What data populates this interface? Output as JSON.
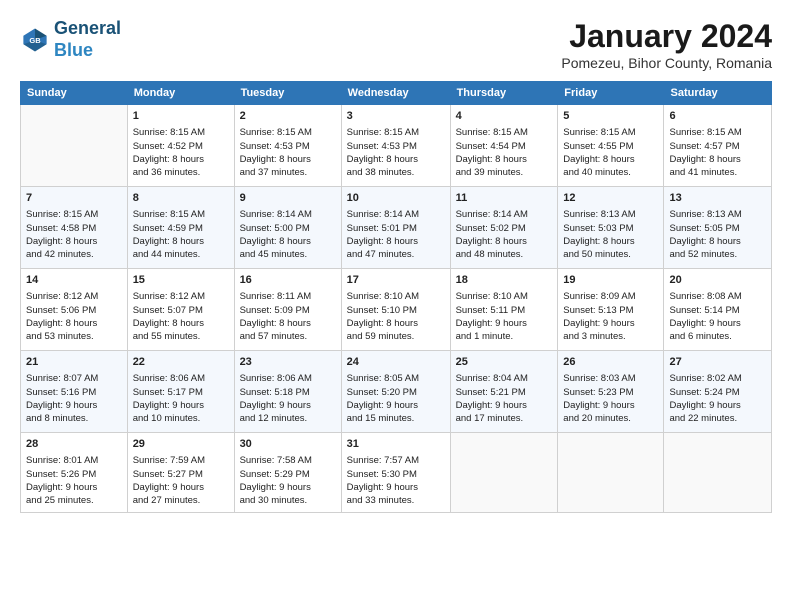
{
  "header": {
    "logo_line1": "General",
    "logo_line2": "Blue",
    "month_title": "January 2024",
    "subtitle": "Pomezeu, Bihor County, Romania"
  },
  "columns": [
    "Sunday",
    "Monday",
    "Tuesday",
    "Wednesday",
    "Thursday",
    "Friday",
    "Saturday"
  ],
  "weeks": [
    [
      {
        "day": "",
        "lines": []
      },
      {
        "day": "1",
        "lines": [
          "Sunrise: 8:15 AM",
          "Sunset: 4:52 PM",
          "Daylight: 8 hours",
          "and 36 minutes."
        ]
      },
      {
        "day": "2",
        "lines": [
          "Sunrise: 8:15 AM",
          "Sunset: 4:53 PM",
          "Daylight: 8 hours",
          "and 37 minutes."
        ]
      },
      {
        "day": "3",
        "lines": [
          "Sunrise: 8:15 AM",
          "Sunset: 4:53 PM",
          "Daylight: 8 hours",
          "and 38 minutes."
        ]
      },
      {
        "day": "4",
        "lines": [
          "Sunrise: 8:15 AM",
          "Sunset: 4:54 PM",
          "Daylight: 8 hours",
          "and 39 minutes."
        ]
      },
      {
        "day": "5",
        "lines": [
          "Sunrise: 8:15 AM",
          "Sunset: 4:55 PM",
          "Daylight: 8 hours",
          "and 40 minutes."
        ]
      },
      {
        "day": "6",
        "lines": [
          "Sunrise: 8:15 AM",
          "Sunset: 4:57 PM",
          "Daylight: 8 hours",
          "and 41 minutes."
        ]
      }
    ],
    [
      {
        "day": "7",
        "lines": [
          "Sunrise: 8:15 AM",
          "Sunset: 4:58 PM",
          "Daylight: 8 hours",
          "and 42 minutes."
        ]
      },
      {
        "day": "8",
        "lines": [
          "Sunrise: 8:15 AM",
          "Sunset: 4:59 PM",
          "Daylight: 8 hours",
          "and 44 minutes."
        ]
      },
      {
        "day": "9",
        "lines": [
          "Sunrise: 8:14 AM",
          "Sunset: 5:00 PM",
          "Daylight: 8 hours",
          "and 45 minutes."
        ]
      },
      {
        "day": "10",
        "lines": [
          "Sunrise: 8:14 AM",
          "Sunset: 5:01 PM",
          "Daylight: 8 hours",
          "and 47 minutes."
        ]
      },
      {
        "day": "11",
        "lines": [
          "Sunrise: 8:14 AM",
          "Sunset: 5:02 PM",
          "Daylight: 8 hours",
          "and 48 minutes."
        ]
      },
      {
        "day": "12",
        "lines": [
          "Sunrise: 8:13 AM",
          "Sunset: 5:03 PM",
          "Daylight: 8 hours",
          "and 50 minutes."
        ]
      },
      {
        "day": "13",
        "lines": [
          "Sunrise: 8:13 AM",
          "Sunset: 5:05 PM",
          "Daylight: 8 hours",
          "and 52 minutes."
        ]
      }
    ],
    [
      {
        "day": "14",
        "lines": [
          "Sunrise: 8:12 AM",
          "Sunset: 5:06 PM",
          "Daylight: 8 hours",
          "and 53 minutes."
        ]
      },
      {
        "day": "15",
        "lines": [
          "Sunrise: 8:12 AM",
          "Sunset: 5:07 PM",
          "Daylight: 8 hours",
          "and 55 minutes."
        ]
      },
      {
        "day": "16",
        "lines": [
          "Sunrise: 8:11 AM",
          "Sunset: 5:09 PM",
          "Daylight: 8 hours",
          "and 57 minutes."
        ]
      },
      {
        "day": "17",
        "lines": [
          "Sunrise: 8:10 AM",
          "Sunset: 5:10 PM",
          "Daylight: 8 hours",
          "and 59 minutes."
        ]
      },
      {
        "day": "18",
        "lines": [
          "Sunrise: 8:10 AM",
          "Sunset: 5:11 PM",
          "Daylight: 9 hours",
          "and 1 minute."
        ]
      },
      {
        "day": "19",
        "lines": [
          "Sunrise: 8:09 AM",
          "Sunset: 5:13 PM",
          "Daylight: 9 hours",
          "and 3 minutes."
        ]
      },
      {
        "day": "20",
        "lines": [
          "Sunrise: 8:08 AM",
          "Sunset: 5:14 PM",
          "Daylight: 9 hours",
          "and 6 minutes."
        ]
      }
    ],
    [
      {
        "day": "21",
        "lines": [
          "Sunrise: 8:07 AM",
          "Sunset: 5:16 PM",
          "Daylight: 9 hours",
          "and 8 minutes."
        ]
      },
      {
        "day": "22",
        "lines": [
          "Sunrise: 8:06 AM",
          "Sunset: 5:17 PM",
          "Daylight: 9 hours",
          "and 10 minutes."
        ]
      },
      {
        "day": "23",
        "lines": [
          "Sunrise: 8:06 AM",
          "Sunset: 5:18 PM",
          "Daylight: 9 hours",
          "and 12 minutes."
        ]
      },
      {
        "day": "24",
        "lines": [
          "Sunrise: 8:05 AM",
          "Sunset: 5:20 PM",
          "Daylight: 9 hours",
          "and 15 minutes."
        ]
      },
      {
        "day": "25",
        "lines": [
          "Sunrise: 8:04 AM",
          "Sunset: 5:21 PM",
          "Daylight: 9 hours",
          "and 17 minutes."
        ]
      },
      {
        "day": "26",
        "lines": [
          "Sunrise: 8:03 AM",
          "Sunset: 5:23 PM",
          "Daylight: 9 hours",
          "and 20 minutes."
        ]
      },
      {
        "day": "27",
        "lines": [
          "Sunrise: 8:02 AM",
          "Sunset: 5:24 PM",
          "Daylight: 9 hours",
          "and 22 minutes."
        ]
      }
    ],
    [
      {
        "day": "28",
        "lines": [
          "Sunrise: 8:01 AM",
          "Sunset: 5:26 PM",
          "Daylight: 9 hours",
          "and 25 minutes."
        ]
      },
      {
        "day": "29",
        "lines": [
          "Sunrise: 7:59 AM",
          "Sunset: 5:27 PM",
          "Daylight: 9 hours",
          "and 27 minutes."
        ]
      },
      {
        "day": "30",
        "lines": [
          "Sunrise: 7:58 AM",
          "Sunset: 5:29 PM",
          "Daylight: 9 hours",
          "and 30 minutes."
        ]
      },
      {
        "day": "31",
        "lines": [
          "Sunrise: 7:57 AM",
          "Sunset: 5:30 PM",
          "Daylight: 9 hours",
          "and 33 minutes."
        ]
      },
      {
        "day": "",
        "lines": []
      },
      {
        "day": "",
        "lines": []
      },
      {
        "day": "",
        "lines": []
      }
    ]
  ]
}
